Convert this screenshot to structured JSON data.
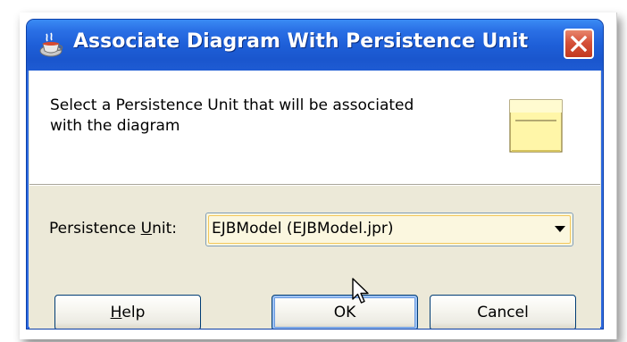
{
  "window": {
    "title": "Associate Diagram With Persistence Unit",
    "icon": "java-cup-icon",
    "close_icon": "close-icon"
  },
  "panel": {
    "description_line1": "Select a Persistence Unit that will be associated",
    "description_line2": "with the diagram",
    "icon": "note-icon"
  },
  "form": {
    "label_prefix": "Persistence ",
    "label_mnemonic": "U",
    "label_suffix": "nit:",
    "selected_value": "EJBModel (EJBModel.jpr)"
  },
  "buttons": {
    "help_mnemonic": "H",
    "help_rest": "elp",
    "ok_label": "OK",
    "cancel_label": "Cancel"
  },
  "colors": {
    "titlebar": "#1e5fd8",
    "close": "#d5513a",
    "dialog_bg": "#ece9d8"
  }
}
